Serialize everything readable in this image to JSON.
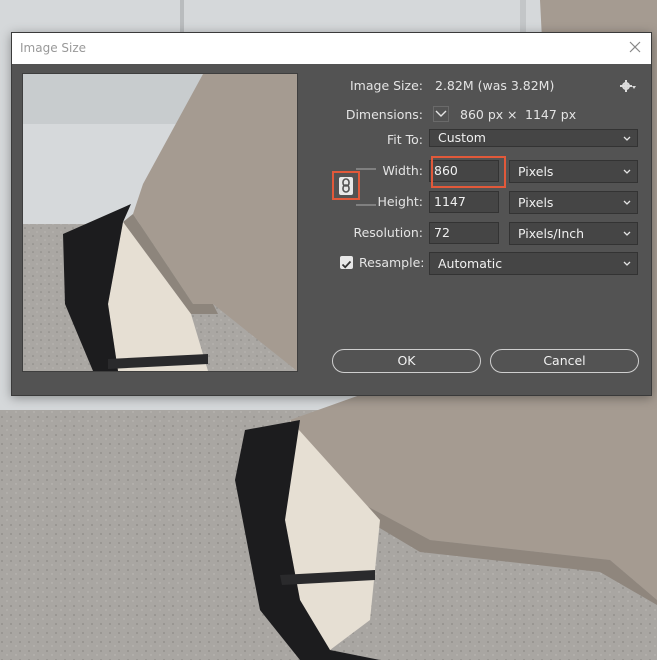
{
  "dialog": {
    "title": "Image Size",
    "image_size_label": "Image Size:",
    "image_size_value": "2.82M (was 3.82M)",
    "dimensions_label": "Dimensions:",
    "dimensions_width": "860 px",
    "dimensions_x": "×",
    "dimensions_height": "1147 px",
    "fit_to_label": "Fit To:",
    "fit_to_value": "Custom",
    "width_label": "Width:",
    "width_value": "860",
    "width_unit": "Pixels",
    "height_label": "Height:",
    "height_value": "1147",
    "height_unit": "Pixels",
    "resolution_label": "Resolution:",
    "resolution_value": "72",
    "resolution_unit": "Pixels/Inch",
    "resample_label": "Resample:",
    "resample_checked": true,
    "resample_value": "Automatic",
    "ok_label": "OK",
    "cancel_label": "Cancel"
  },
  "colors": {
    "dialog_bg": "#535353",
    "highlight": "#e2593a"
  },
  "icons": [
    "close-icon",
    "gear-icon",
    "chain-link-icon",
    "chevron-down-icon",
    "checkmark-icon"
  ]
}
